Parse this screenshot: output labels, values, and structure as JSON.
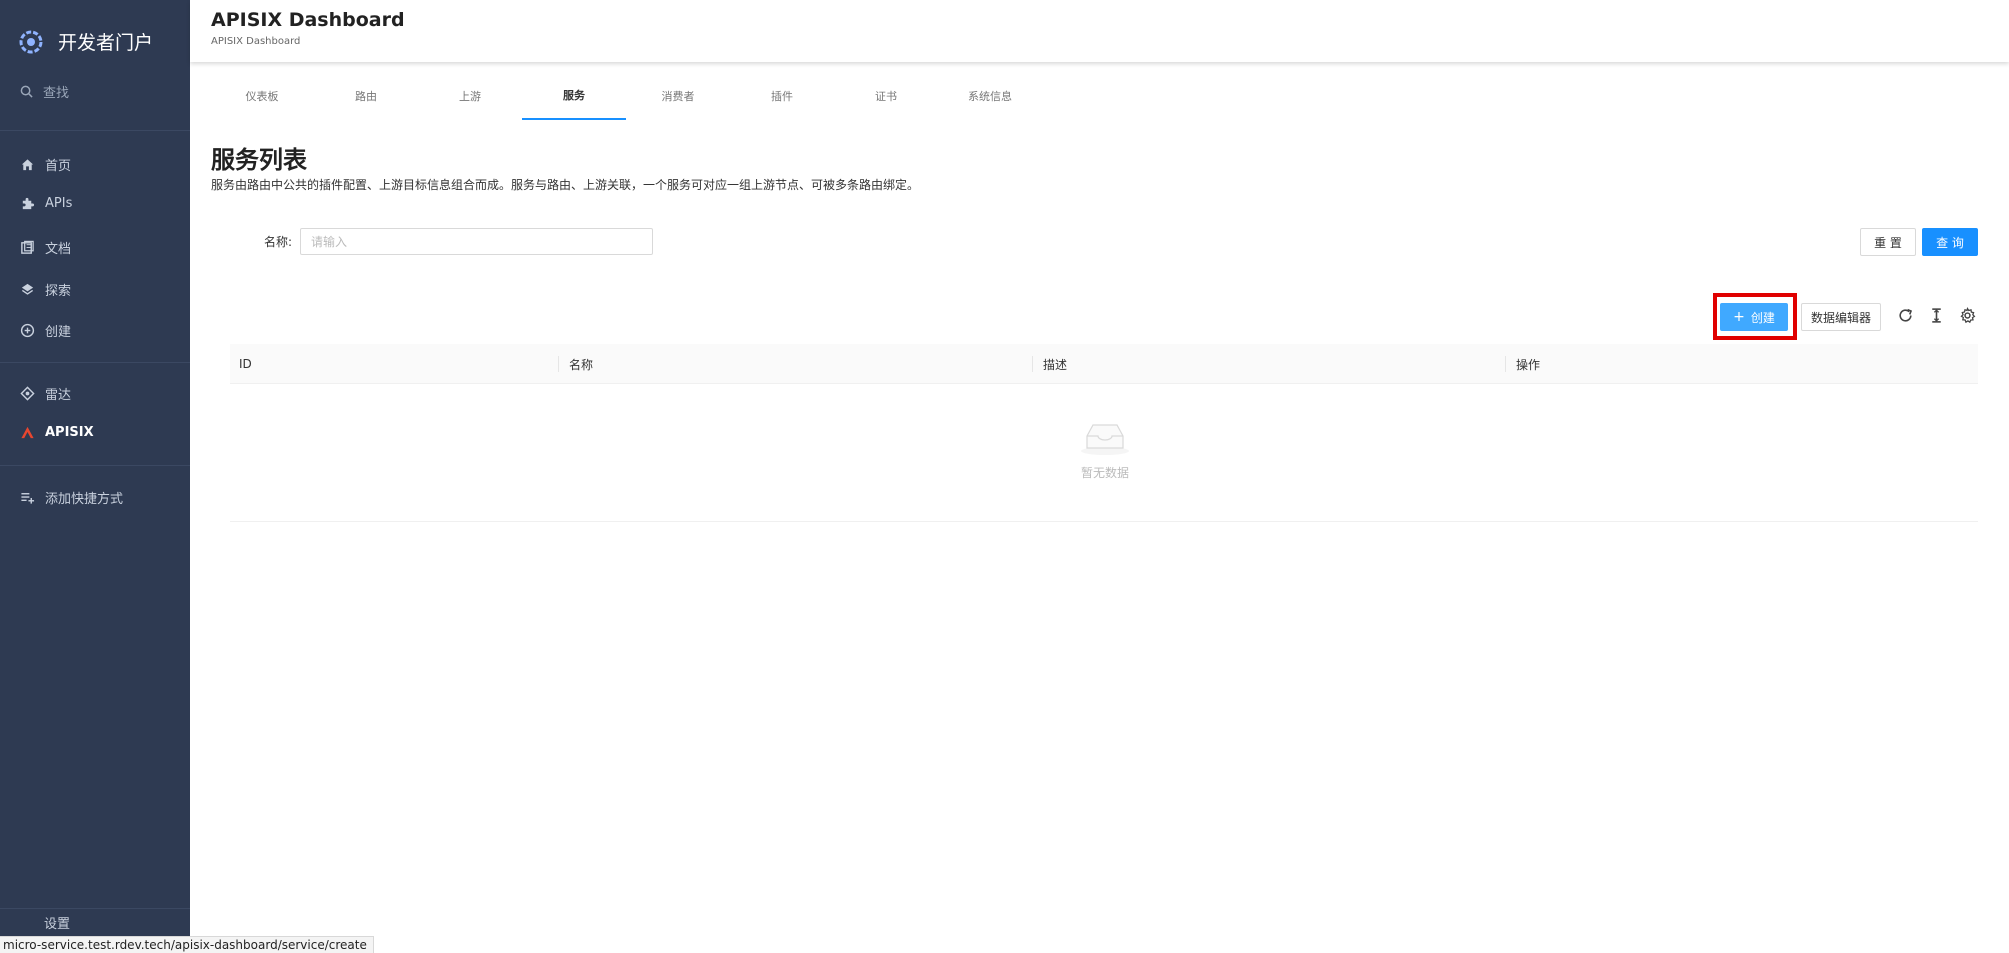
{
  "sidebar": {
    "brand": "开发者门户",
    "search_label": "查找",
    "items": [
      {
        "label": "首页",
        "icon": "home-icon"
      },
      {
        "label": "APIs",
        "icon": "puzzle-icon"
      },
      {
        "label": "文档",
        "icon": "docs-icon"
      },
      {
        "label": "探索",
        "icon": "layers-icon"
      },
      {
        "label": "创建",
        "icon": "plus-circle-icon"
      },
      {
        "label": "雷达",
        "icon": "radar-icon"
      },
      {
        "label": "APISIX",
        "icon": "apisix-icon"
      },
      {
        "label": "添加快捷方式",
        "icon": "playlist-add-icon"
      }
    ],
    "bottom_label": "设置"
  },
  "header": {
    "title": "APISIX Dashboard",
    "subtitle": "APISIX Dashboard"
  },
  "tabs": [
    "仪表板",
    "路由",
    "上游",
    "服务",
    "消费者",
    "插件",
    "证书",
    "系统信息"
  ],
  "active_tab": "服务",
  "page": {
    "title": "服务列表",
    "description": "服务由路由中公共的插件配置、上游目标信息组合而成。服务与路由、上游关联，一个服务可对应一组上游节点、可被多条路由绑定。"
  },
  "filter": {
    "label": "名称:",
    "placeholder": "请输入",
    "value": "",
    "reset_label": "重 置",
    "query_label": "查 询"
  },
  "toolbar": {
    "create_label": "创建",
    "data_editor_label": "数据编辑器"
  },
  "table": {
    "columns": [
      "ID",
      "名称",
      "描述",
      "操作"
    ],
    "empty_text": "暂无数据"
  },
  "status_url": "micro-service.test.rdev.tech/apisix-dashboard/service/create",
  "colors": {
    "sidebar_bg": "#2e3a52",
    "primary": "#1890ff",
    "highlight": "#e00000"
  }
}
